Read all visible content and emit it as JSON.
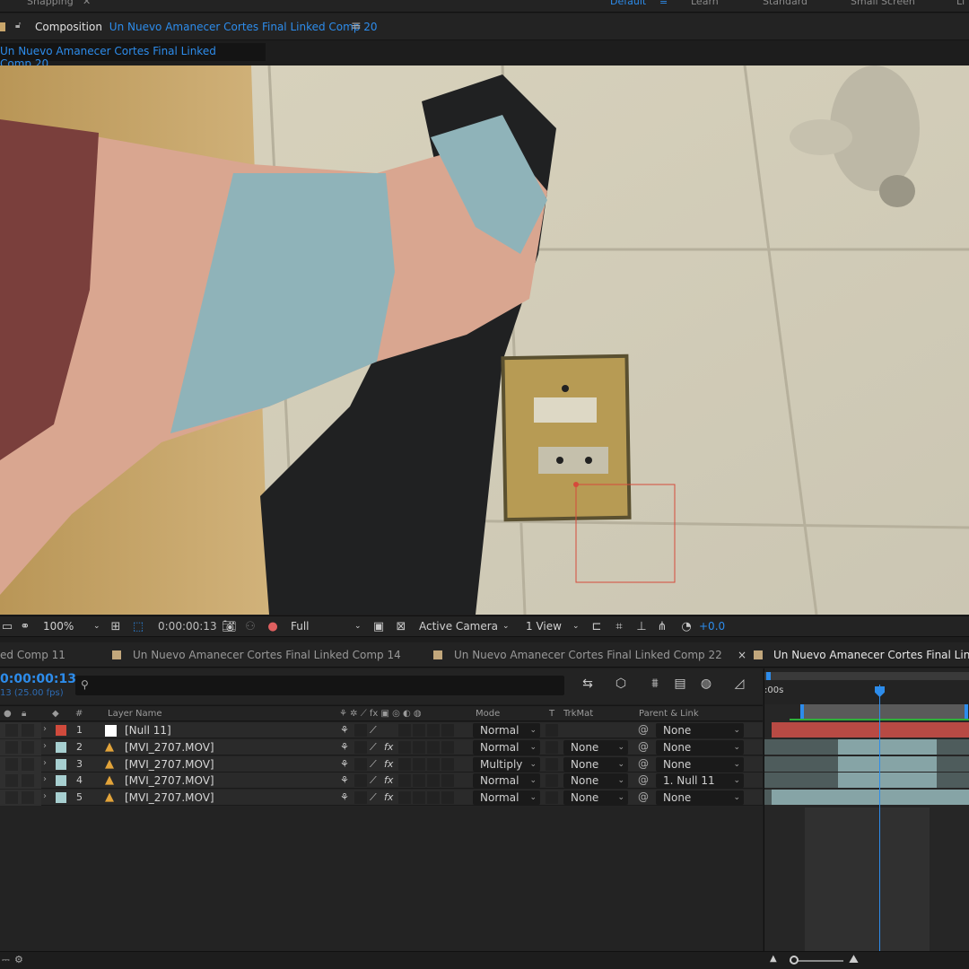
{
  "workspace": {
    "snapping_label": "Snapping",
    "items": [
      "Default",
      "Learn",
      "Standard",
      "Small Screen",
      "Li"
    ]
  },
  "composition_panel": {
    "label": "Composition",
    "comp_name": "Un Nuevo Amanecer Cortes Final Linked Comp 20",
    "breadcrumb": "Un Nuevo Amanecer Cortes Final Linked Comp 20"
  },
  "viewer_toolbar": {
    "zoom": "100%",
    "timecode": "0:00:00:13",
    "resolution": "Full",
    "camera": "Active Camera",
    "views": "1 View",
    "exposure": "+0.0"
  },
  "timeline_tabs": [
    {
      "label": "ed Comp 11",
      "active": false
    },
    {
      "label": "Un Nuevo Amanecer Cortes Final Linked Comp 14",
      "active": false
    },
    {
      "label": "Un Nuevo Amanecer Cortes Final Linked Comp 22",
      "active": false
    },
    {
      "label": "Un Nuevo Amanecer Cortes Final Linked",
      "active": true
    }
  ],
  "timeline": {
    "timecode": "0:00:00:13",
    "fps": "13 (25.00 fps)",
    "ruler_start": ":00s"
  },
  "columns": {
    "number": "#",
    "layer_name": "Layer Name",
    "mode": "Mode",
    "t": "T",
    "trkmat": "TrkMat",
    "parent": "Parent & Link"
  },
  "layers": [
    {
      "num": "1",
      "name": "[Null 11]",
      "type": "null",
      "label_color": "#d04a3c",
      "mode": "Normal",
      "trkmat": "",
      "parent": "None",
      "fx": false
    },
    {
      "num": "2",
      "name": "[MVI_2707.MOV]",
      "type": "footage",
      "label_color": "#a7cfd0",
      "mode": "Normal",
      "trkmat": "None",
      "parent": "None",
      "fx": true
    },
    {
      "num": "3",
      "name": "[MVI_2707.MOV]",
      "type": "footage",
      "label_color": "#a7cfd0",
      "mode": "Multiply",
      "trkmat": "None",
      "parent": "None",
      "fx": true
    },
    {
      "num": "4",
      "name": "[MVI_2707.MOV]",
      "type": "footage",
      "label_color": "#a7cfd0",
      "mode": "Normal",
      "trkmat": "None",
      "parent": "1. Null 11",
      "fx": true
    },
    {
      "num": "5",
      "name": "[MVI_2707.MOV]",
      "type": "footage",
      "label_color": "#a7cfd0",
      "mode": "Normal",
      "trkmat": "None",
      "parent": "None",
      "fx": true
    }
  ],
  "colors": {
    "accent": "#2d8ceb",
    "null_label": "#d04a3c",
    "footage_label": "#a7cfd0"
  }
}
